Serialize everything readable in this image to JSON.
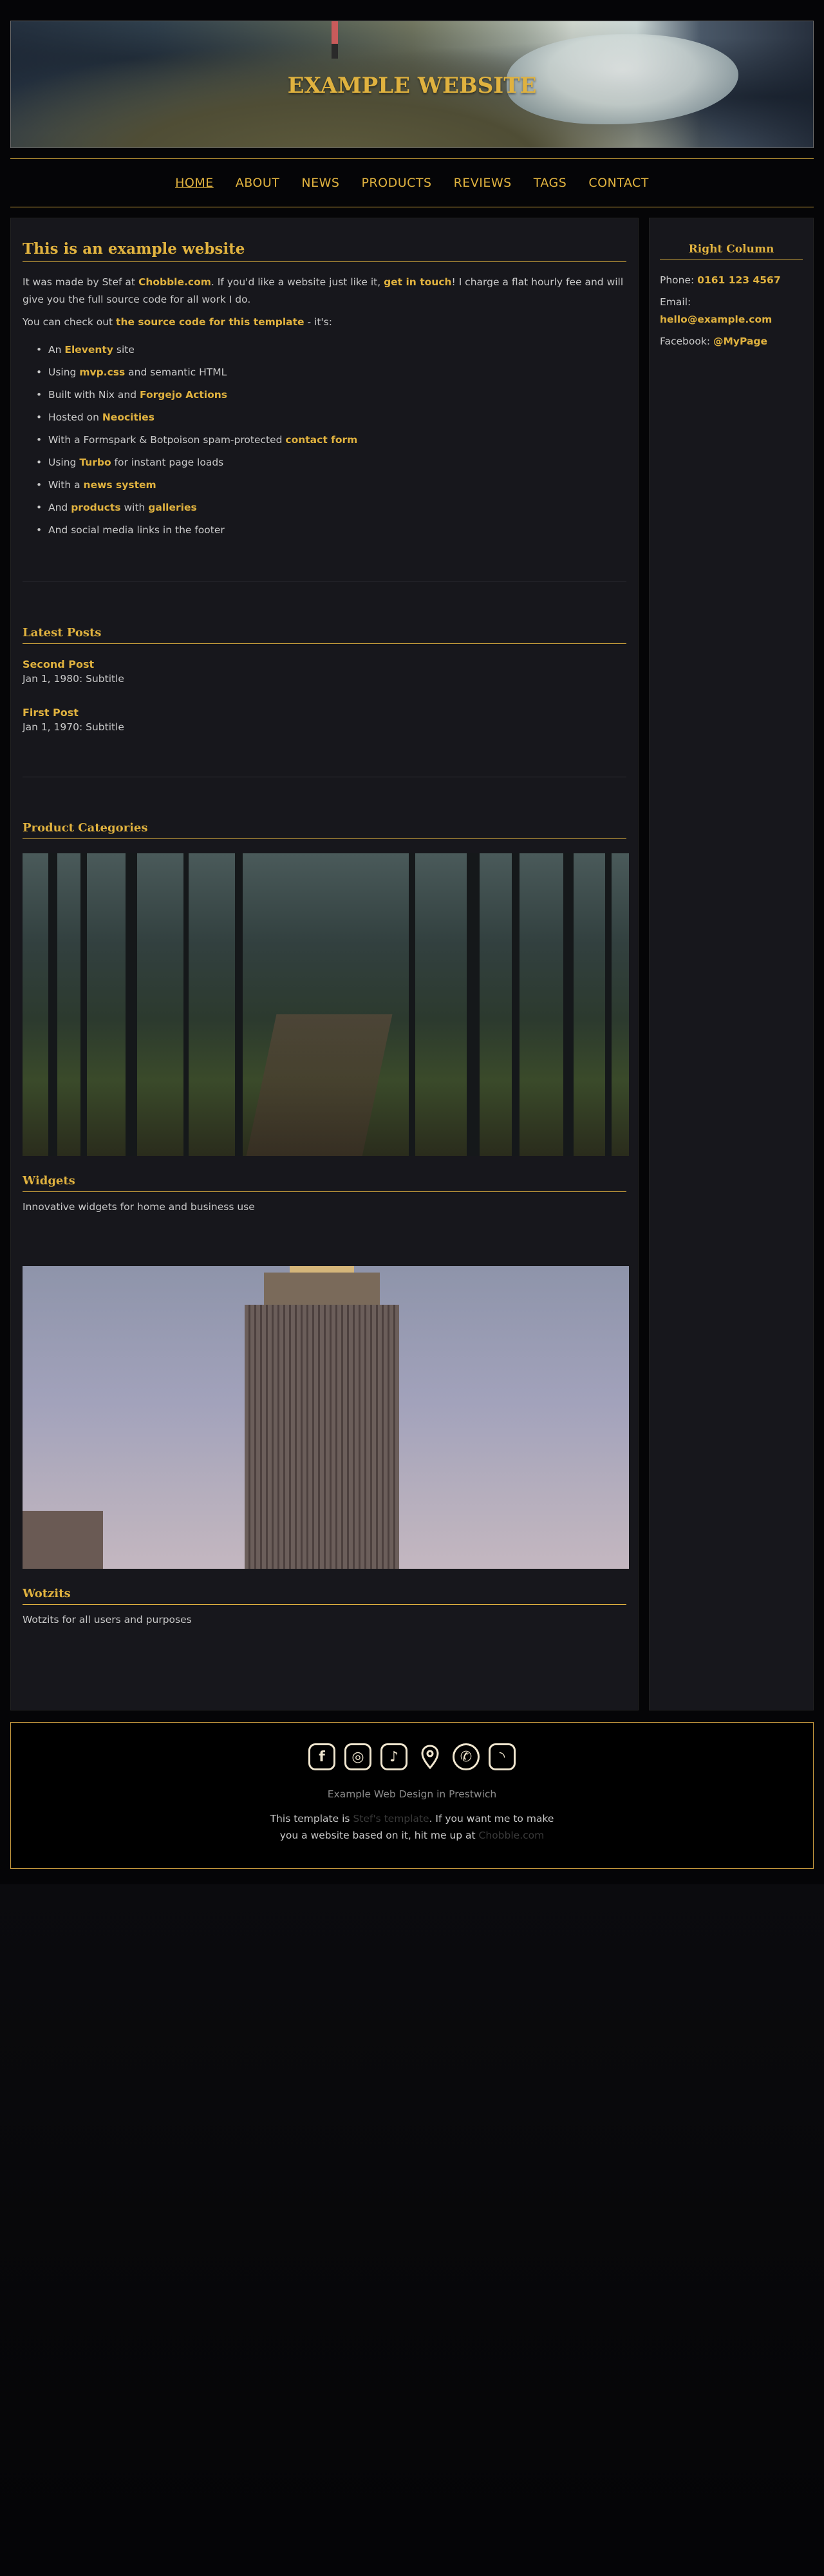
{
  "header": {
    "site_title": "EXAMPLE WEBSITE"
  },
  "nav": {
    "items": [
      "HOME",
      "ABOUT",
      "NEWS",
      "PRODUCTS",
      "REVIEWS",
      "TAGS",
      "CONTACT"
    ],
    "active": "HOME"
  },
  "intro": {
    "heading": "This is an example website",
    "p1_a": "It was made by Stef at ",
    "p1_link1": "Chobble.com",
    "p1_b": ". If you'd like a website just like it, ",
    "p1_link2": "get in touch",
    "p1_c": "! I charge a flat hourly fee and will give you the full source code for all work I do.",
    "p2_a": "You can check out ",
    "p2_link": "the source code for this template",
    "p2_b": " - it's:",
    "features": [
      {
        "pre": "An ",
        "link": "Eleventy",
        "post": " site"
      },
      {
        "pre": "Using ",
        "link": "mvp.css",
        "post": " and semantic HTML"
      },
      {
        "pre": "Built with Nix and ",
        "link": "Forgejo Actions",
        "post": ""
      },
      {
        "pre": "Hosted on ",
        "link": "Neocities",
        "post": ""
      },
      {
        "pre": "With a Formspark & Botpoison spam-protected ",
        "link": "contact form",
        "post": ""
      },
      {
        "pre": "Using ",
        "link": "Turbo",
        "post": " for instant page loads"
      },
      {
        "pre": "With a ",
        "link": "news system",
        "post": ""
      },
      {
        "pre": "And ",
        "link": "products",
        "post": " with "
      },
      {
        "pre": "And social media links in the footer",
        "link": "",
        "post": ""
      }
    ],
    "feature8_link2": "galleries"
  },
  "latest": {
    "heading": "Latest Posts",
    "posts": [
      {
        "title": "Second Post",
        "date": "Jan 1, 1980:",
        "subtitle": " Subtitle"
      },
      {
        "title": "First Post",
        "date": "Jan 1, 1970:",
        "subtitle": " Subtitle"
      }
    ]
  },
  "categories": {
    "heading": "Product Categories",
    "items": [
      {
        "name": "Widgets",
        "desc": "Innovative widgets for home and business use"
      },
      {
        "name": "Wotzits",
        "desc": "Wotzits for all users and purposes"
      }
    ]
  },
  "aside": {
    "heading": "Right Column",
    "phone_label": "Phone: ",
    "phone": "0161 123 4567",
    "email_label": "Email: ",
    "email": "hello@example.com",
    "facebook_label": "Facebook: ",
    "facebook": "@MyPage"
  },
  "footer": {
    "icons": [
      "facebook-icon",
      "instagram-icon",
      "tiktok-icon",
      "map-pin-icon",
      "whatsapp-icon",
      "rss-icon"
    ],
    "tagline": "Example Web Design in Prestwich",
    "l1_a": "This template is ",
    "l1_link": "Stef's template",
    "l1_b": ". If you want me to make",
    "l2_a": "you a website based on it, hit me up at ",
    "l2_link": "Chobble.com"
  },
  "colors": {
    "accent": "#e0b23f",
    "panel": "#17171c",
    "background": "#050507"
  }
}
